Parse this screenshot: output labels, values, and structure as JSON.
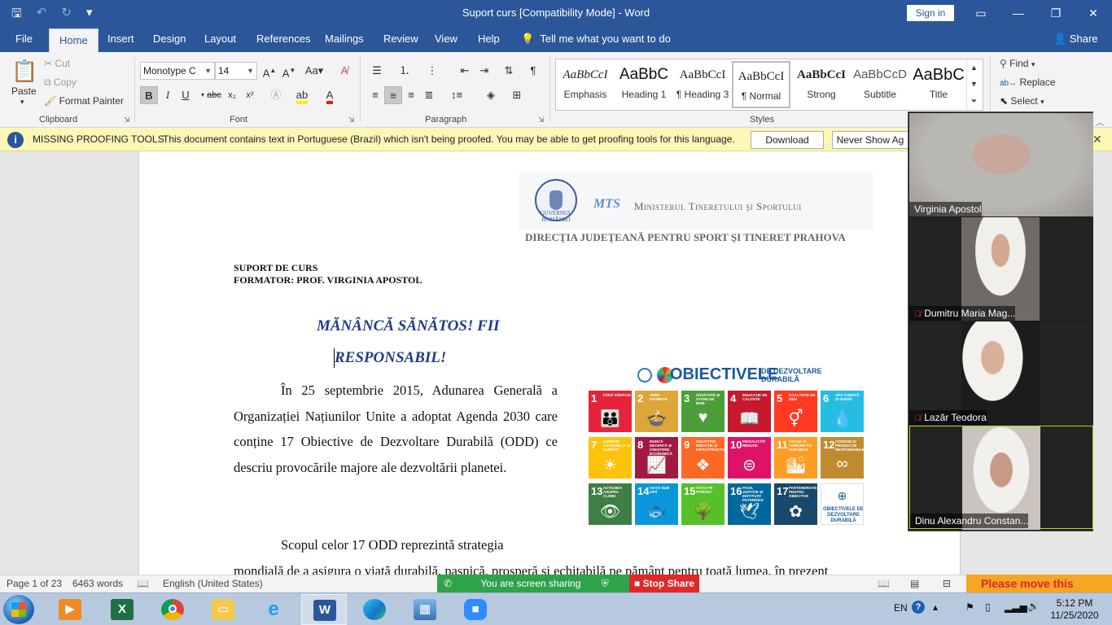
{
  "window": {
    "title": "Suport curs  [Compatibility Mode]  -  Word",
    "sign_in": "Sign in",
    "qat_icons": [
      "save-icon",
      "undo-icon",
      "redo-icon",
      "customize-icon"
    ],
    "controls": [
      "ribbon-display-icon",
      "minimize-icon",
      "maximize-icon",
      "close-icon"
    ]
  },
  "tabs": [
    {
      "label": "File"
    },
    {
      "label": "Home"
    },
    {
      "label": "Insert"
    },
    {
      "label": "Design"
    },
    {
      "label": "Layout"
    },
    {
      "label": "References"
    },
    {
      "label": "Mailings"
    },
    {
      "label": "Review"
    },
    {
      "label": "View"
    },
    {
      "label": "Help"
    }
  ],
  "tell_me": "Tell me what you want to do",
  "share": "Share",
  "ribbon": {
    "clipboard": {
      "label": "Clipboard",
      "paste": "Paste",
      "cut": "Cut",
      "copy": "Copy",
      "format_painter": "Format Painter"
    },
    "font": {
      "label": "Font",
      "font_name": "Monotype C",
      "font_size": "14"
    },
    "paragraph": {
      "label": "Paragraph"
    },
    "styles": {
      "label": "Styles",
      "items": [
        {
          "preview": "AaBbCcI",
          "name": "Emphasis"
        },
        {
          "preview": "AaBbC",
          "name": "Heading 1"
        },
        {
          "preview": "AaBbCcI",
          "name": "¶ Heading 3"
        },
        {
          "preview": "AaBbCcI",
          "name": "¶ Normal"
        },
        {
          "preview": "AaBbCcI",
          "name": "Strong"
        },
        {
          "preview": "AaBbCcD",
          "name": "Subtitle"
        },
        {
          "preview": "AaBbC",
          "name": "Title"
        }
      ]
    },
    "editing": {
      "find": "Find",
      "replace": "Replace",
      "select": "Select"
    }
  },
  "message_bar": {
    "heading": "MISSING PROOFING TOOLS",
    "text": "This document contains text in Portuguese (Brazil) which isn't being proofed. You may be able to get proofing tools for this language.",
    "download": "Download",
    "never_show": "Never Show Ag"
  },
  "document": {
    "seal_text": "GUVERNUL ROMÂNIEI",
    "mts": "MTS",
    "ministry": "Ministerul Tineretului şi Sportului",
    "directia": "DIRECŢIA JUDEŢEANĂ PENTRU SPORT ŞI TINERET PRAHOVA",
    "suport": "SUPORT DE CURS",
    "formator": "FORMATOR: PROF. VIRGINIA APOSTOL",
    "title_line1": "MĂNÂNCĂ SĂNĂTOS!   FII",
    "title_line2": "RESPONSABIL!",
    "para1": "În 25 septembrie 2015, Adunarea Generală a Organizației Națiunilor Unite a adoptat Agenda 2030 care conține 17 Obiective de Dezvoltare Durabilă (ODD) ce descriu provocările majore ale dezvoltării planetei.",
    "para2": "Scopul celor 17 ODD reprezintă strategia",
    "para2b": "mondială de a asigura o viață durabilă, pașnică, prosperă și echitabilă pe pământ pentru toată lumea, în prezent",
    "sdg": {
      "title": "OBIECTIVELE",
      "subtitle_1": "DE DEZVOLTARE",
      "subtitle_2": "DURABILĂ",
      "tiles": [
        {
          "n": "1",
          "label": "Fără sărăcie",
          "color": "#e5243b",
          "glyph": "👪"
        },
        {
          "n": "2",
          "label": "Zero foamete",
          "color": "#dda63a",
          "glyph": "🍲"
        },
        {
          "n": "3",
          "label": "Sănătate și stare de bine",
          "color": "#4c9f38",
          "glyph": "♥"
        },
        {
          "n": "4",
          "label": "Educație de calitate",
          "color": "#c5192d",
          "glyph": "📖"
        },
        {
          "n": "5",
          "label": "Egalitate de gen",
          "color": "#ff3a21",
          "glyph": "⚥"
        },
        {
          "n": "6",
          "label": "Apă curată și igienă",
          "color": "#26bde2",
          "glyph": "💧"
        },
        {
          "n": "7",
          "label": "Energie accesibilă și curată",
          "color": "#fcc30b",
          "glyph": "☀"
        },
        {
          "n": "8",
          "label": "Muncă decentă și creștere economică",
          "color": "#a21942",
          "glyph": "📈"
        },
        {
          "n": "9",
          "label": "Industrie, inovație și infrastructură",
          "color": "#fd6925",
          "glyph": "❖"
        },
        {
          "n": "10",
          "label": "Inegalități reduse",
          "color": "#dd1367",
          "glyph": "⊜"
        },
        {
          "n": "11",
          "label": "Orașe și comunități durabile",
          "color": "#fd9d24",
          "glyph": "🏙"
        },
        {
          "n": "12",
          "label": "Consum și producție responsabile",
          "color": "#bf8b2e",
          "glyph": "∞"
        },
        {
          "n": "13",
          "label": "Acțiunea asupra climei",
          "color": "#3f7e44",
          "glyph": "👁"
        },
        {
          "n": "14",
          "label": "Viața sub apă",
          "color": "#0a97d9",
          "glyph": "🐟"
        },
        {
          "n": "15",
          "label": "Viața pe pământ",
          "color": "#56c02b",
          "glyph": "🌳"
        },
        {
          "n": "16",
          "label": "Pace, justiție și instituții puternice",
          "color": "#00689d",
          "glyph": "🕊"
        },
        {
          "n": "17",
          "label": "Parteneriate pentru obiective",
          "color": "#19486a",
          "glyph": "✿"
        }
      ],
      "logo_label": "OBIECTIVELE DE DEZVOLTARE DURABILĂ"
    }
  },
  "meeting": {
    "participants": [
      {
        "name": "Virginia Apostol",
        "muted": false
      },
      {
        "name": "Dumitru Maria Mag...",
        "muted": true
      },
      {
        "name": "Lazăr Teodora",
        "muted": true
      },
      {
        "name": "Dinu Alexandru Constan...",
        "muted": false
      }
    ]
  },
  "status": {
    "page": "Page 1 of 23",
    "words": "6463 words",
    "language": "English (United States)",
    "sharing": "You are screen sharing",
    "stop_share": "Stop Share",
    "move_banner": "Please move this"
  },
  "taskbar": {
    "lang": "EN",
    "time": "5:12 PM",
    "date": "11/25/2020",
    "apps": [
      "media-player-icon",
      "excel-icon",
      "chrome-icon",
      "file-explorer-icon",
      "internet-explorer-icon",
      "word-icon",
      "edge-icon",
      "photos-icon",
      "zoom-icon"
    ]
  }
}
